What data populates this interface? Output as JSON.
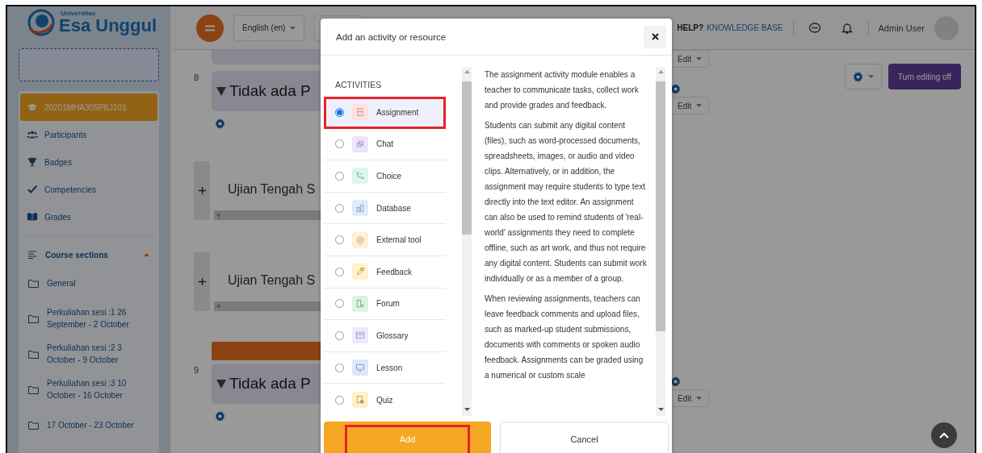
{
  "sidebar": {
    "logo": {
      "small": "Universitas",
      "name": "Esa Unggul"
    },
    "items": [
      {
        "label": "20201MHA305PKJ101",
        "selected": true
      },
      {
        "label": "Participants",
        "selected": false
      },
      {
        "label": "Badges",
        "selected": false
      },
      {
        "label": "Competencies",
        "selected": false
      },
      {
        "label": "Grades",
        "selected": false
      }
    ],
    "sections_heading": "Course sections",
    "sections_expanded": true,
    "sections": [
      "General",
      "Perkuliahan sesi :1 26 September - 2 October",
      "Perkuliahan sesi :2 3 October - 9 October",
      "Perkuliahan sesi :3 10 October - 16 October",
      "17 October - 23 October"
    ]
  },
  "topbar": {
    "language": "English (en)",
    "help": "HELP?",
    "help_link": "KNOWLEDGE BASE",
    "user": "Admin User"
  },
  "content": [
    {
      "kind": "stub",
      "edit": "Edit"
    },
    {
      "kind": "section",
      "number": "8",
      "title": "Tidak ada P",
      "edit": "Edit"
    },
    {
      "kind": "activity",
      "title": "Ujian Tengah S"
    },
    {
      "kind": "activity",
      "title": "Ujian Tengah S"
    },
    {
      "kind": "bar"
    },
    {
      "kind": "section",
      "number": "9",
      "title": "Tidak ada P",
      "edit": "Edit"
    }
  ],
  "editing_button": "Turn editing off",
  "modal": {
    "title": "Add an activity or resource",
    "heading": "ACTIVITIES",
    "activities": [
      {
        "name": "Assignment",
        "color": "#fde2df",
        "selected": true,
        "highlighted": true
      },
      {
        "name": "Chat",
        "color": "#ece4fa",
        "selected": false,
        "highlighted": false
      },
      {
        "name": "Choice",
        "color": "#dcf6ef",
        "selected": false,
        "highlighted": false
      },
      {
        "name": "Database",
        "color": "#e0ebfb",
        "selected": false,
        "highlighted": false
      },
      {
        "name": "External tool",
        "color": "#fdf0d8",
        "selected": false,
        "highlighted": false
      },
      {
        "name": "Feedback",
        "color": "#fdf1cf",
        "selected": false,
        "highlighted": false
      },
      {
        "name": "Forum",
        "color": "#daf3e3",
        "selected": false,
        "highlighted": false
      },
      {
        "name": "Glossary",
        "color": "#ebeafc",
        "selected": false,
        "highlighted": false
      },
      {
        "name": "Lesson",
        "color": "#dde7fb",
        "selected": false,
        "highlighted": false
      },
      {
        "name": "Quiz",
        "color": "#fdf1cd",
        "selected": false,
        "highlighted": false
      }
    ],
    "description": [
      "The assignment activity module enables a teacher to communicate tasks, collect work and provide grades and feedback.",
      "Students can submit any digital content (files), such as word-processed documents, spreadsheets, images, or audio and video clips. Alternatively, or in addition, the assignment may require students to type text directly into the text editor. An assignment can also be used to remind students of 'real-world' assignments they need to complete offline, such as art work, and thus not require any digital content. Students can submit work individually or as a member of a group.",
      "When reviewing assignments, teachers can leave feedback comments and upload files, such as marked-up student submissions, documents with comments or spoken audio feedback. Assignments can be graded using a numerical or custom scale"
    ],
    "buttons": [
      {
        "label": "Add",
        "kind": "primary",
        "highlighted": true
      },
      {
        "label": "Cancel",
        "kind": "secondary",
        "highlighted": false
      }
    ]
  }
}
